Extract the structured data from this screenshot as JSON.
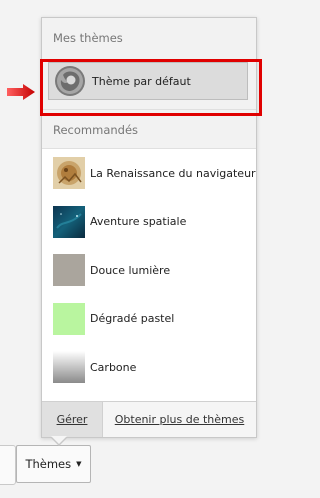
{
  "my_themes": {
    "header": "Mes thèmes",
    "current": {
      "label": "Thème par défaut",
      "icon": "firefox-logo-icon"
    }
  },
  "recommended": {
    "header": "Recommandés",
    "items": [
      {
        "label": "La Renaissance du navigateur",
        "icon": "renaissance-thumbnail"
      },
      {
        "label": "Aventure spatiale",
        "icon": "space-thumbnail"
      },
      {
        "label": "Douce lumière",
        "icon": "soft-light-thumbnail"
      },
      {
        "label": "Dégradé pastel",
        "icon": "pastel-gradient-thumbnail"
      },
      {
        "label": "Carbone",
        "icon": "carbon-thumbnail"
      }
    ]
  },
  "footer": {
    "manage_label": "Gérer",
    "more_label": "Obtenir plus de thèmes"
  },
  "toolbar": {
    "themes_label": "Thèmes"
  },
  "colors": {
    "highlight": "#e00000",
    "accent_arrow": "#d40000"
  }
}
